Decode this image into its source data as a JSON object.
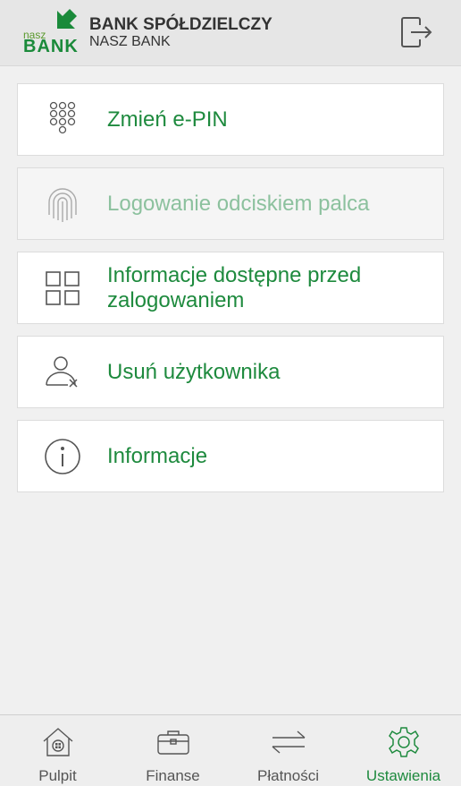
{
  "header": {
    "logo_top": "nasz",
    "logo_bottom": "BANK",
    "bank_name": "BANK SPÓŁDZIELCZY",
    "bank_sub": "NASZ BANK",
    "logout_icon": "logout-icon"
  },
  "menu": {
    "items": [
      {
        "label": "Zmień e-PIN",
        "icon": "keypad-icon",
        "enabled": true
      },
      {
        "label": "Logowanie odciskiem palca",
        "icon": "fingerprint-icon",
        "enabled": false
      },
      {
        "label": "Informacje dostępne przed zalogowaniem",
        "icon": "grid-icon",
        "enabled": true
      },
      {
        "label": "Usuń użytkownika",
        "icon": "remove-user-icon",
        "enabled": true
      },
      {
        "label": "Informacje",
        "icon": "info-icon",
        "enabled": true
      }
    ]
  },
  "tabbar": {
    "tabs": [
      {
        "label": "Pulpit",
        "icon": "home-icon",
        "active": false
      },
      {
        "label": "Finanse",
        "icon": "wallet-icon",
        "active": false
      },
      {
        "label": "Płatności",
        "icon": "transfer-icon",
        "active": false
      },
      {
        "label": "Ustawienia",
        "icon": "gear-icon",
        "active": true
      }
    ]
  },
  "colors": {
    "accent": "#1e8a3e",
    "disabled_text": "#8cc19e",
    "header_bg": "#e6e6e6",
    "page_bg": "#f0f0f0"
  }
}
